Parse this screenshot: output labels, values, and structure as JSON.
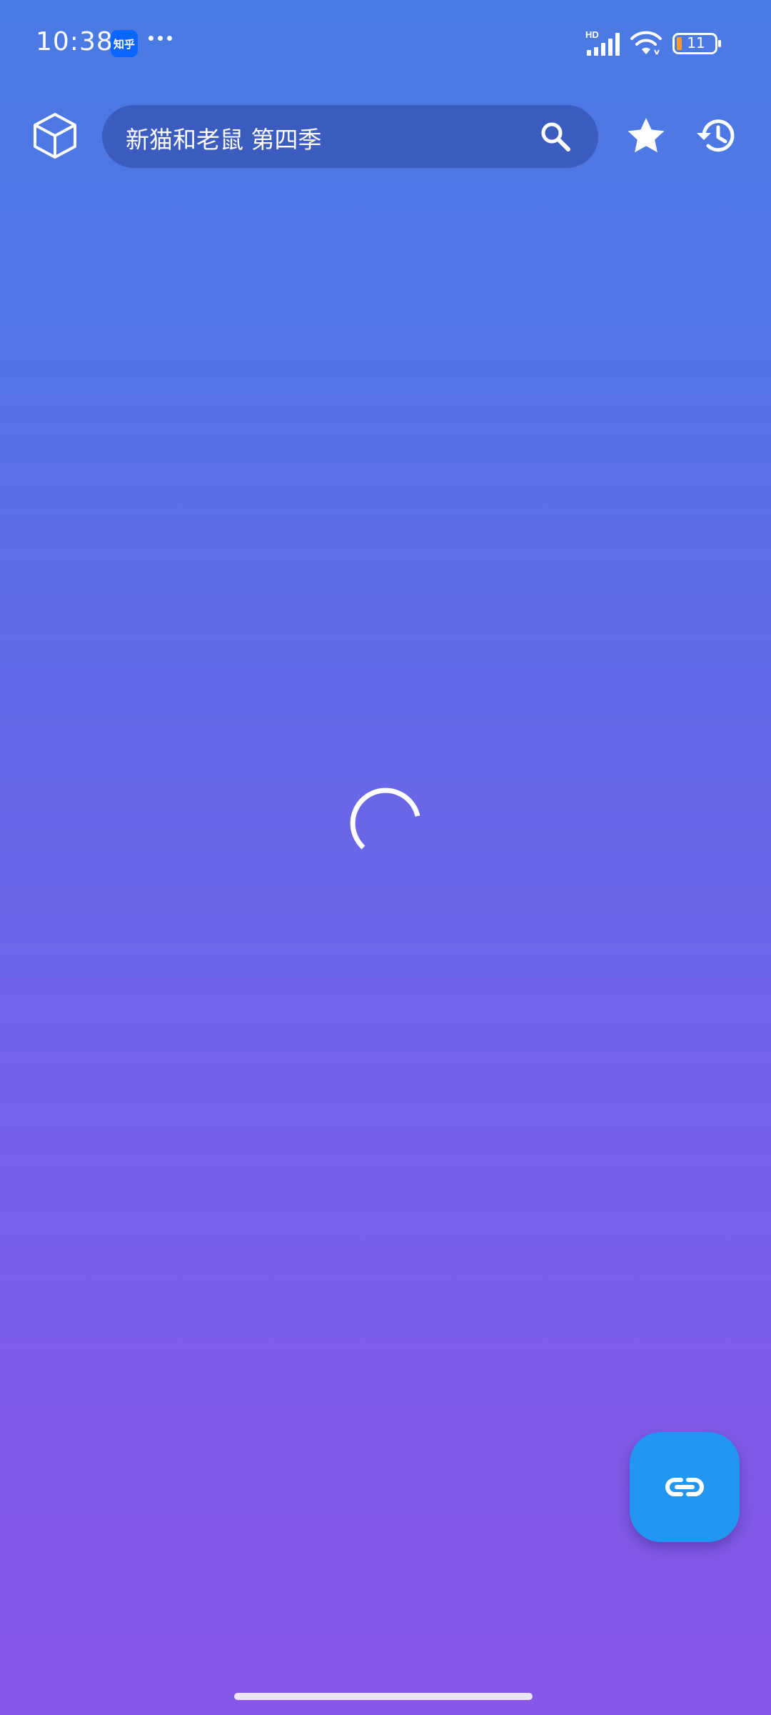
{
  "status_bar": {
    "time": "10:38",
    "notification_app_label": "知乎",
    "battery_level": "11",
    "network_label": "HD"
  },
  "top_bar": {
    "search": {
      "query": "新猫和老鼠 第四季"
    },
    "icons": {
      "left": "cube-icon",
      "search": "search-icon",
      "favorites": "star-icon",
      "history": "history-icon"
    }
  },
  "content": {
    "state": "loading"
  },
  "fab": {
    "icon": "link-icon",
    "color": "#2196f3"
  },
  "theme": {
    "gradient_top": "#4a7be3",
    "gradient_bottom": "#8757e8"
  }
}
